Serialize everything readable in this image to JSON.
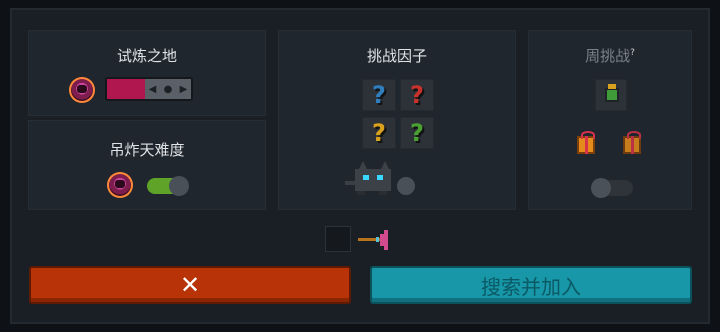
{
  "trial": {
    "title": "试炼之地"
  },
  "bomb": {
    "title": "吊炸天难度",
    "enabled": true
  },
  "factors": {
    "title": "挑战因子",
    "tiles": [
      {
        "glyph": "?",
        "color": "#2f7fbf"
      },
      {
        "glyph": "?",
        "color": "#c8322b"
      },
      {
        "glyph": "?",
        "color": "#d9a21c"
      },
      {
        "glyph": "?",
        "color": "#4aa132"
      }
    ]
  },
  "weekly": {
    "title": "周挑战",
    "help": "?",
    "enabled": false
  },
  "buttons": {
    "cancel": "✕",
    "join": "搜索并加入"
  },
  "colors": {
    "accent_pink": "#b0174e",
    "toggle_on": "#5fa329",
    "cancel": "#b83408",
    "join": "#1797a8"
  }
}
